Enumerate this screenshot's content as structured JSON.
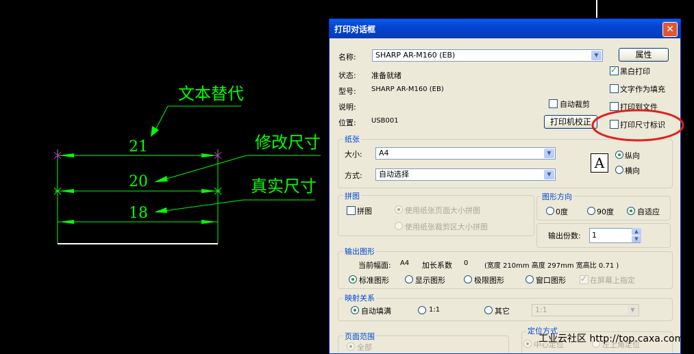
{
  "cad": {
    "labels": {
      "text_replace": "文本替代",
      "modify_dim": "修改尺寸",
      "real_dim": "真实尺寸"
    },
    "dimensions": {
      "d1": "21",
      "d2": "20",
      "d3": "18"
    },
    "colors": {
      "line": "#00ff00",
      "ext": "#ff00ff",
      "base": "#ffffff"
    }
  },
  "dialog": {
    "title": "打印对话框",
    "close_icon": "close-icon",
    "printer": {
      "name_label": "名称:",
      "name_value": "SHARP AR-M160 (EB)",
      "status_label": "状态:",
      "status_value": "准备就绪",
      "model_label": "型号:",
      "model_value": "SHARP AR-M160 (EB)",
      "desc_label": "说明:",
      "location_label": "位置:",
      "location_value": "USB001",
      "properties_button": "属性",
      "auto_crop": "自动裁剪",
      "calibrate_button": "打印机校正"
    },
    "options": {
      "black_white": "黑白打印",
      "text_as_fill": "文字作为填充",
      "print_to_file": "打印到文件",
      "print_dim_marks": "打印尺寸标识"
    },
    "paper": {
      "group_title": "纸张",
      "size_label": "大小:",
      "size_value": "A4",
      "mode_label": "方式:",
      "mode_value": "自动选择",
      "portrait": "纵向",
      "landscape": "横向",
      "icon_letter": "A"
    },
    "tile": {
      "group_title": "拼图",
      "tile_check": "拼图",
      "opt1": "使用纸张页面大小拼图",
      "opt2": "使用纸张裁剪区大小拼图"
    },
    "orientation": {
      "group_title": "图形方向",
      "deg0": "0度",
      "deg90": "90度",
      "adaptive": "自适应"
    },
    "copies": {
      "label": "输出份数:",
      "value": "1"
    },
    "output": {
      "group_title": "输出图形",
      "info_label": "当前幅面:",
      "info_size": "A4",
      "factor_label": "加长系数",
      "factor_value": "0",
      "detail": "(宽度  210mm   高度   297mm   宽高比 0.71 )",
      "standard": "标准图形",
      "display": "显示图形",
      "limit": "极限图形",
      "window": "窗口图形",
      "on_screen": "在屏幕上指定"
    },
    "mapping": {
      "group_title": "映射关系",
      "auto_fill": "自动填满",
      "one_to_one": "1:1",
      "other": "其它",
      "other_value": "1:1"
    },
    "range": {
      "group_title": "页面范围",
      "all": "全部"
    },
    "position": {
      "group_title": "定位方式",
      "center": "中心定位",
      "top_left": "左上角定位"
    }
  },
  "annotation": {
    "color": "#e02020"
  },
  "watermark": "工业云社区 http://top.caxa.com/"
}
